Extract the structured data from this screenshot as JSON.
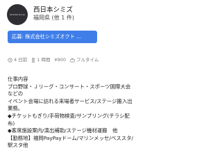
{
  "header": {
    "logo_text": "Oriental Group",
    "company_name": "西日本シミズ",
    "location": "福岡県 (他 1 件)"
  },
  "apply_button": {
    "label": "応募: 株式会社シミズオクト ..."
  },
  "meta": {
    "posted": "4 日前",
    "duration": "1 時間",
    "pay": "¥900",
    "employment": "フルタイム"
  },
  "description": {
    "title": "仕事内容",
    "lines": [
      "プロ野球・Ｊリーグ・コンサート・スポーツ国際大会",
      "などの",
      "イベント会場に訪れる来場者サービス/ステージ搬入出",
      "業務。",
      "◆チケットもぎり/手荷物検査/サンプリング(チラシ配",
      "布)",
      "◆客席施設案内/演出補助/ステージ機材運搬　他",
      "【勤務地】福岡PayPayドーム/マリンメッセ/ベススタ/",
      "駅スタ他"
    ]
  },
  "icons": {
    "posted": "clock-icon",
    "duration": "hourglass-icon",
    "pay": "yen-icon",
    "employment": "briefcase-icon"
  }
}
